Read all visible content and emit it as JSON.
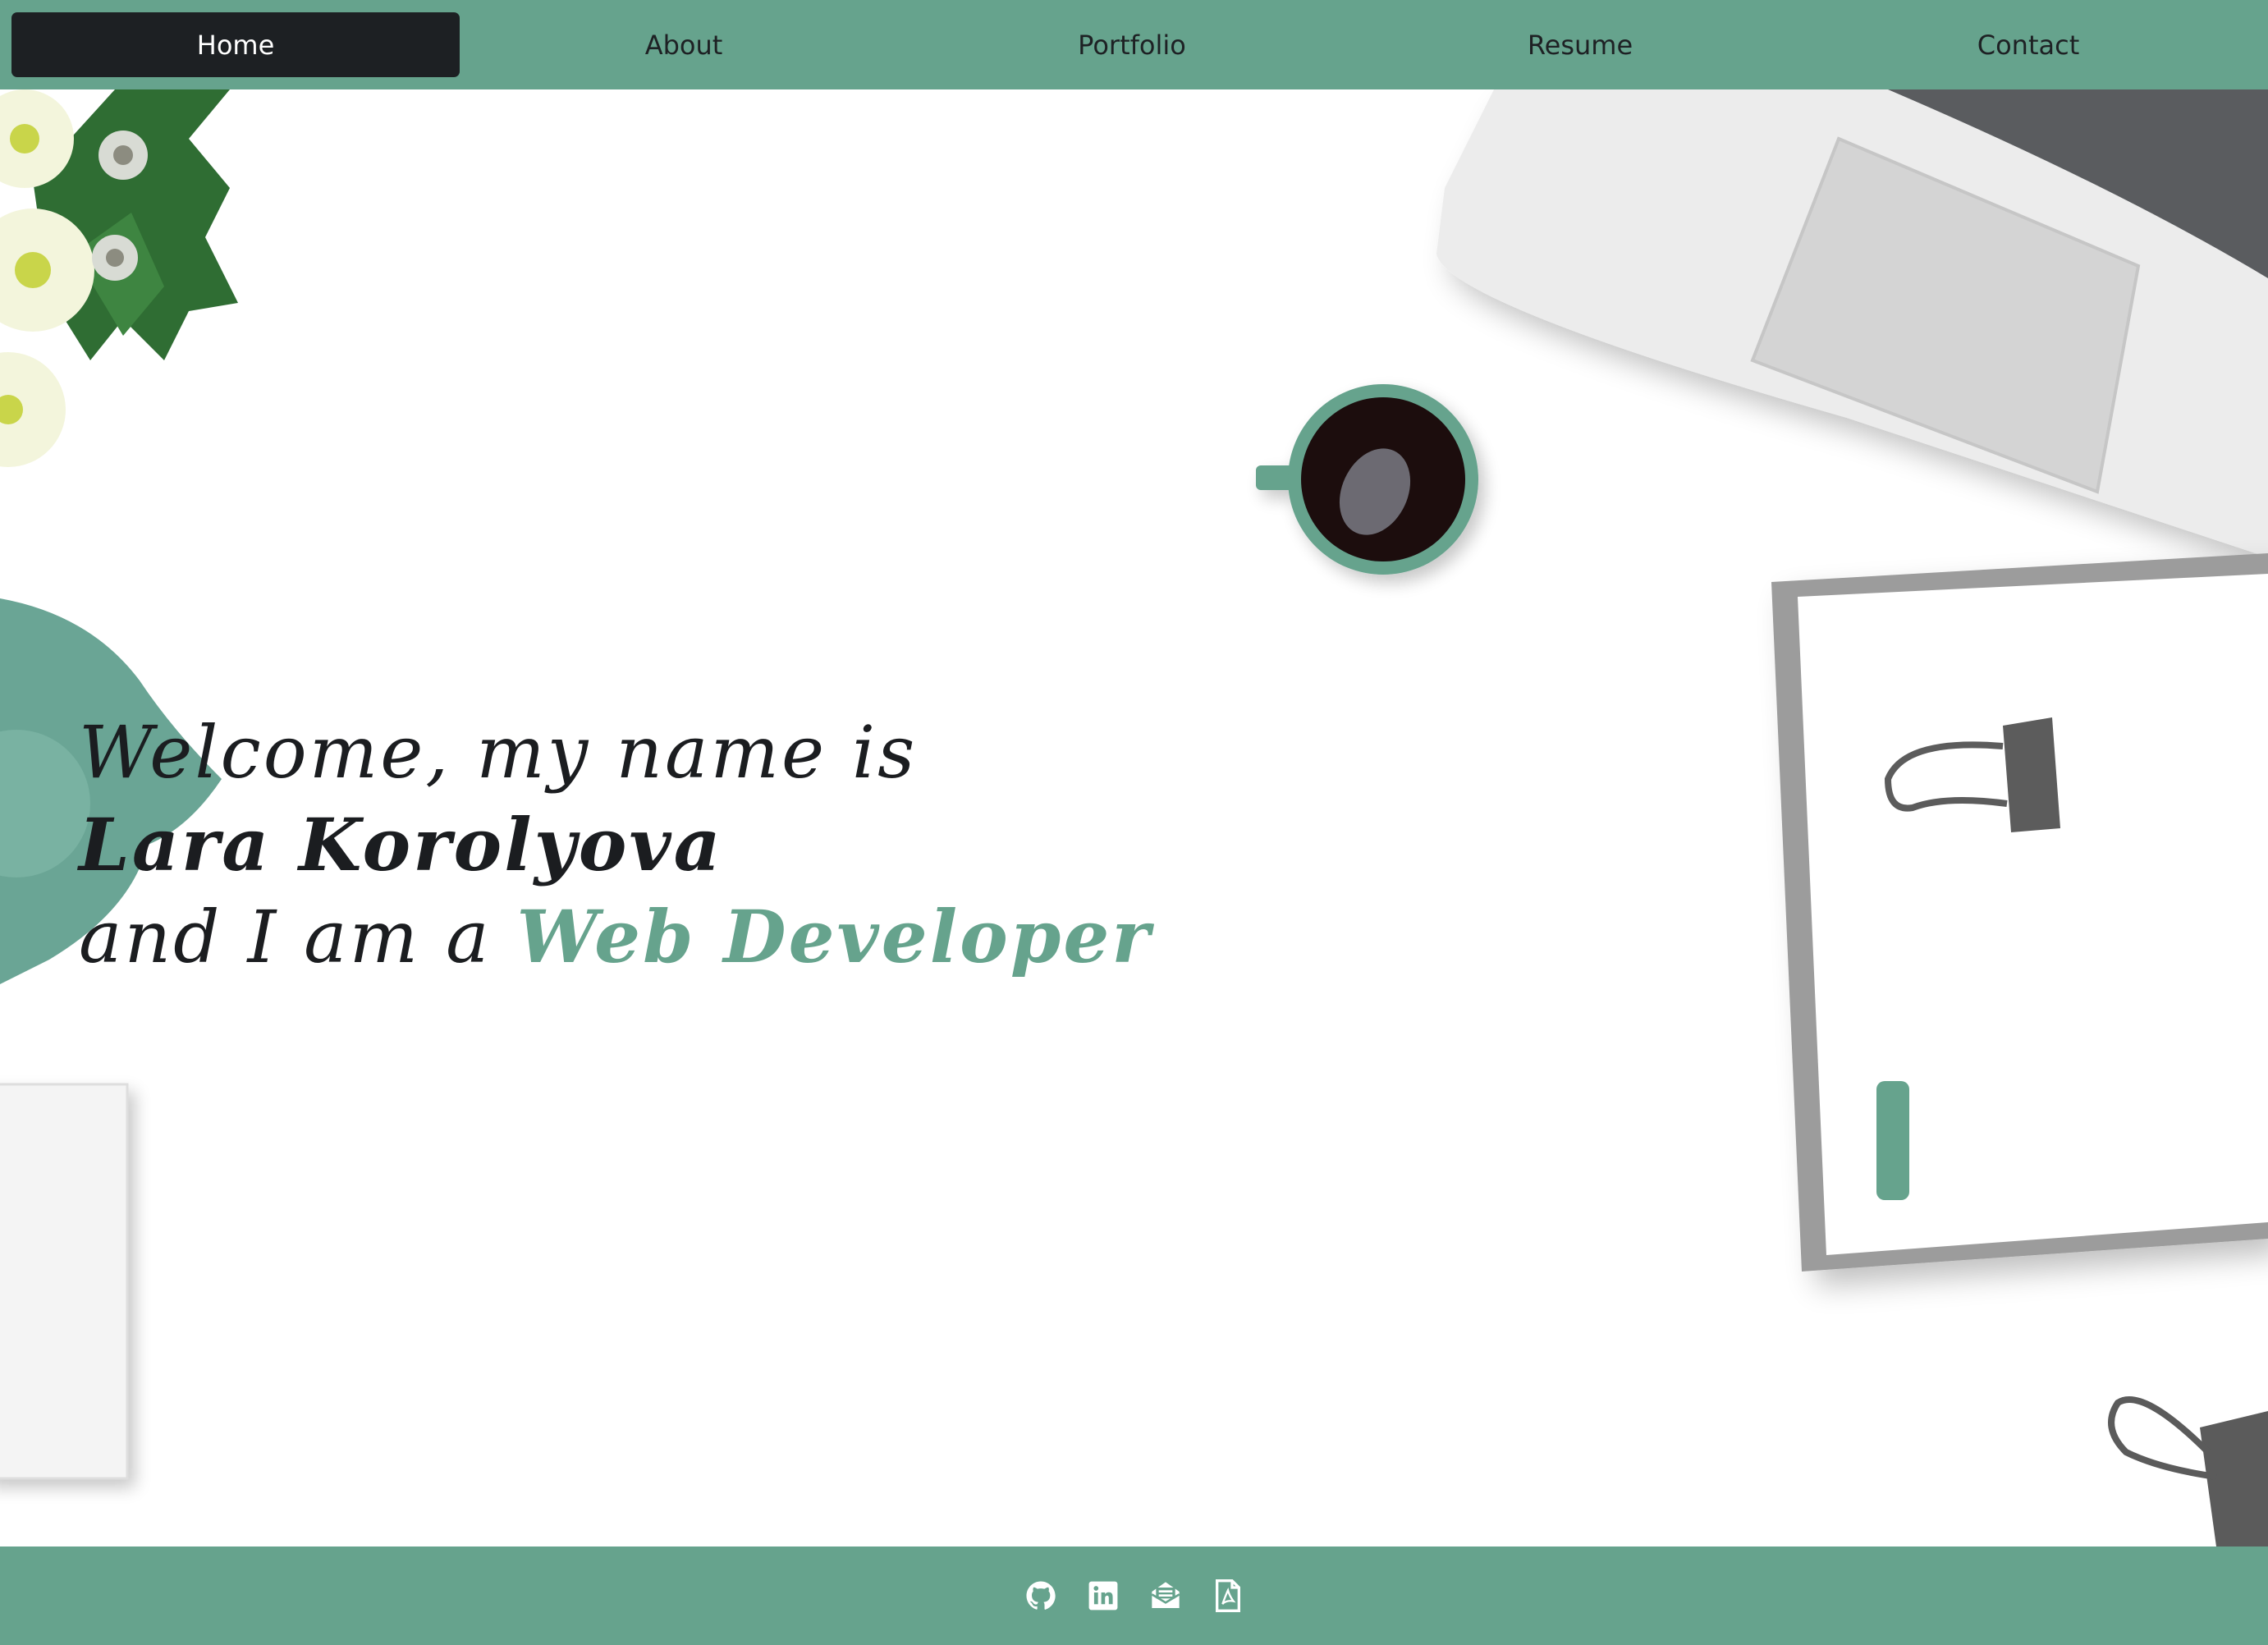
{
  "nav": {
    "items": [
      {
        "label": "Home",
        "active": true
      },
      {
        "label": "About",
        "active": false
      },
      {
        "label": "Portfolio",
        "active": false
      },
      {
        "label": "Resume",
        "active": false
      },
      {
        "label": "Contact",
        "active": false
      }
    ]
  },
  "hero": {
    "line1": "Welcome, my name is",
    "name": "Lara Korolyova",
    "line3_prefix": "and I am a ",
    "role": "Web Developer"
  },
  "footer": {
    "icons": [
      "github-icon",
      "linkedin-icon",
      "email-icon",
      "pdf-resume-icon"
    ]
  },
  "colors": {
    "accent": "#66a38d",
    "dark": "#1d2023",
    "background": "#ffffff"
  }
}
